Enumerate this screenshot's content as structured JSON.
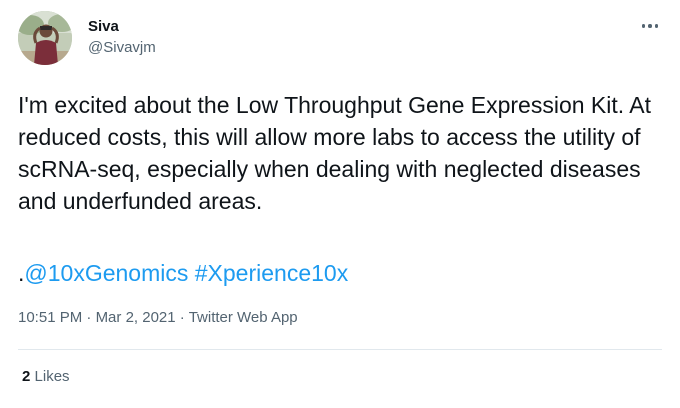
{
  "author": {
    "name": "Siva",
    "handle": "@Sivavjm"
  },
  "tweet": {
    "text": "I'm excited about the Low Throughput Gene Expression Kit. At reduced costs, this will allow more labs to access the utility of scRNA-seq, especially when dealing with neglected diseases and underfunded areas.",
    "mention_prefix": ".",
    "mention": "@10xGenomics",
    "hashtag": "#Xperience10x"
  },
  "meta": {
    "time": "10:51 PM",
    "separator1": "·",
    "date": "Mar 2, 2021",
    "separator2": "·",
    "source": "Twitter Web App"
  },
  "stats": {
    "likes_count": "2",
    "likes_label": "Likes"
  },
  "icons": {
    "more": "more-horizontal-icon",
    "avatar": "profile-avatar"
  },
  "colors": {
    "link": "#1d9bf0",
    "secondary_text": "#536471",
    "primary_text": "#0f1419",
    "divider": "#e1e8ed"
  }
}
